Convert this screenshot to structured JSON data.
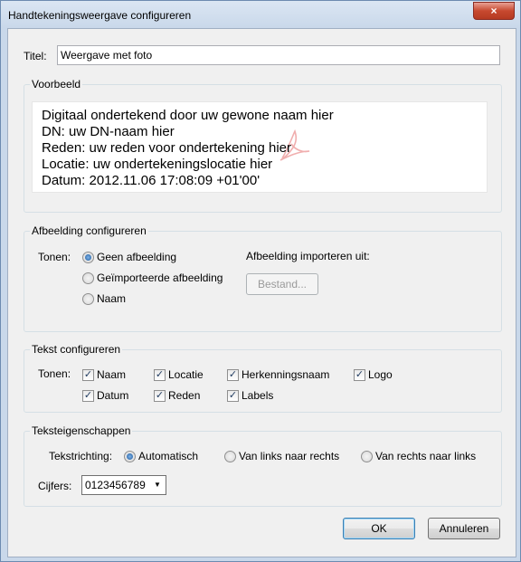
{
  "window": {
    "title": "Handtekeningsweergave configureren",
    "close_glyph": "×"
  },
  "title_field": {
    "label": "Titel:",
    "value": "Weergave met foto"
  },
  "preview": {
    "legend": "Voorbeeld",
    "lines": [
      "Digitaal ondertekend door uw gewone naam hier",
      "DN: uw DN-naam hier",
      "Reden: uw reden voor ondertekening hier",
      "Locatie: uw ondertekeningslocatie hier",
      "Datum: 2012.11.06 17:08:09 +01'00'"
    ]
  },
  "image_config": {
    "legend": "Afbeelding configureren",
    "show_label": "Tonen:",
    "options": [
      "Geen afbeelding",
      "Geïmporteerde afbeelding",
      "Naam"
    ],
    "selected": "Geen afbeelding",
    "import_label": "Afbeelding importeren uit:",
    "file_button": "Bestand..."
  },
  "text_config": {
    "legend": "Tekst configureren",
    "show_label": "Tonen:",
    "checkboxes": [
      {
        "label": "Naam",
        "checked": true
      },
      {
        "label": "Locatie",
        "checked": true
      },
      {
        "label": "Herkenningsnaam",
        "checked": true
      },
      {
        "label": "Logo",
        "checked": true
      },
      {
        "label": "Datum",
        "checked": true
      },
      {
        "label": "Reden",
        "checked": true
      },
      {
        "label": "Labels",
        "checked": true
      }
    ]
  },
  "text_props": {
    "legend": "Teksteigenschappen",
    "direction_label": "Tekstrichting:",
    "directions": [
      "Automatisch",
      "Van links naar rechts",
      "Van rechts naar links"
    ],
    "selected_direction": "Automatisch",
    "digits_label": "Cijfers:",
    "digits_value": "0123456789"
  },
  "buttons": {
    "ok": "OK",
    "cancel": "Annuleren"
  },
  "colors": {
    "accent": "#1d5a9e",
    "watermark": "#e98b8b"
  }
}
